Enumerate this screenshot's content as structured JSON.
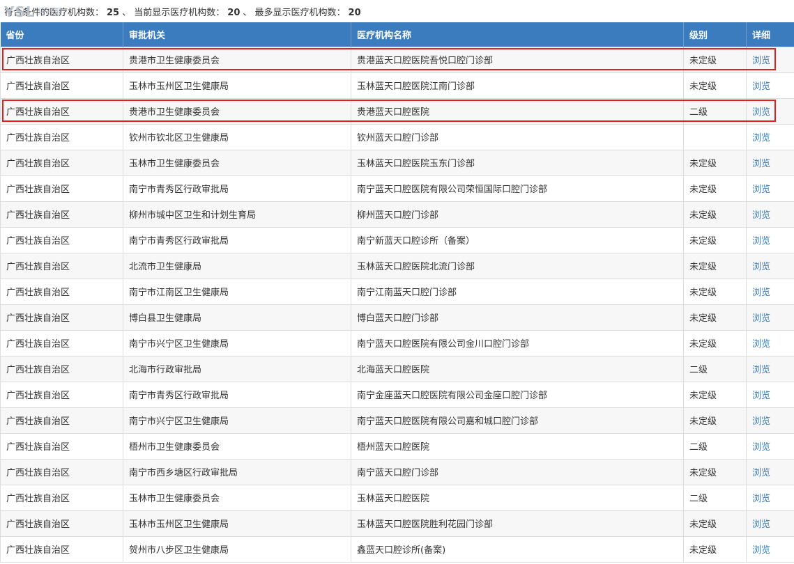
{
  "summary": {
    "label_total": "符合条件的医疗机构数：",
    "total": "25",
    "sep1": "、",
    "label_shown": "当前显示医疗机构数：",
    "shown": "20",
    "sep2": "、",
    "label_max": "最多显示医疗机构数：",
    "max": "20"
  },
  "watermark": {
    "latin": "YSL",
    "cjk": "牙舒丽"
  },
  "headers": {
    "province": "省份",
    "authority": "审批机关",
    "name": "医疗机构名称",
    "level": "级别",
    "detail": "详细"
  },
  "colors": {
    "header_bg": "#3a7cbd",
    "link": "#3a7cbd",
    "highlight": "#e0201f"
  },
  "highlighted_rows": [
    0,
    2
  ],
  "rows": [
    {
      "province": "广西壮族自治区",
      "authority": "贵港市卫生健康委员会",
      "name": "贵港蓝天口腔医院吾悦口腔门诊部",
      "level": "未定级",
      "detail": "浏览"
    },
    {
      "province": "广西壮族自治区",
      "authority": "玉林市玉州区卫生健康局",
      "name": "玉林蓝天口腔医院江南门诊部",
      "level": "未定级",
      "detail": "浏览"
    },
    {
      "province": "广西壮族自治区",
      "authority": "贵港市卫生健康委员会",
      "name": "贵港蓝天口腔医院",
      "level": "二级",
      "detail": "浏览"
    },
    {
      "province": "广西壮族自治区",
      "authority": "钦州市钦北区卫生健康局",
      "name": "钦州蓝天口腔门诊部",
      "level": "",
      "detail": "浏览"
    },
    {
      "province": "广西壮族自治区",
      "authority": "玉林市卫生健康委员会",
      "name": "玉林蓝天口腔医院玉东门诊部",
      "level": "未定级",
      "detail": "浏览"
    },
    {
      "province": "广西壮族自治区",
      "authority": "南宁市青秀区行政审批局",
      "name": "南宁蓝天口腔医院有限公司荣恒国际口腔门诊部",
      "level": "未定级",
      "detail": "浏览"
    },
    {
      "province": "广西壮族自治区",
      "authority": "柳州市城中区卫生和计划生育局",
      "name": "柳州蓝天口腔门诊部",
      "level": "未定级",
      "detail": "浏览"
    },
    {
      "province": "广西壮族自治区",
      "authority": "南宁市青秀区行政审批局",
      "name": "南宁新蓝天口腔诊所（备案）",
      "level": "未定级",
      "detail": "浏览"
    },
    {
      "province": "广西壮族自治区",
      "authority": "北流市卫生健康局",
      "name": "玉林蓝天口腔医院北流门诊部",
      "level": "未定级",
      "detail": "浏览"
    },
    {
      "province": "广西壮族自治区",
      "authority": "南宁市江南区卫生健康局",
      "name": "南宁江南蓝天口腔门诊部",
      "level": "未定级",
      "detail": "浏览"
    },
    {
      "province": "广西壮族自治区",
      "authority": "博白县卫生健康局",
      "name": "博白蓝天口腔门诊部",
      "level": "未定级",
      "detail": "浏览"
    },
    {
      "province": "广西壮族自治区",
      "authority": "南宁市兴宁区卫生健康局",
      "name": "南宁蓝天口腔医院有限公司金川口腔门诊部",
      "level": "未定级",
      "detail": "浏览"
    },
    {
      "province": "广西壮族自治区",
      "authority": "北海市行政审批局",
      "name": "北海蓝天口腔医院",
      "level": "二级",
      "detail": "浏览"
    },
    {
      "province": "广西壮族自治区",
      "authority": "南宁市青秀区行政审批局",
      "name": "南宁金座蓝天口腔医院有限公司金座口腔门诊部",
      "level": "未定级",
      "detail": "浏览"
    },
    {
      "province": "广西壮族自治区",
      "authority": "南宁市兴宁区卫生健康局",
      "name": "南宁蓝天口腔医院有限公司嘉和城口腔门诊部",
      "level": "未定级",
      "detail": "浏览"
    },
    {
      "province": "广西壮族自治区",
      "authority": "梧州市卫生健康委员会",
      "name": "梧州蓝天口腔医院",
      "level": "二级",
      "detail": "浏览"
    },
    {
      "province": "广西壮族自治区",
      "authority": "南宁市西乡塘区行政审批局",
      "name": "南宁蓝天口腔门诊部",
      "level": "未定级",
      "detail": "浏览"
    },
    {
      "province": "广西壮族自治区",
      "authority": "玉林市卫生健康委员会",
      "name": "玉林蓝天口腔医院",
      "level": "二级",
      "detail": "浏览"
    },
    {
      "province": "广西壮族自治区",
      "authority": "玉林市玉州区卫生健康局",
      "name": "玉林蓝天口腔医院胜利花园门诊部",
      "level": "未定级",
      "detail": "浏览"
    },
    {
      "province": "广西壮族自治区",
      "authority": "贺州市八步区卫生健康局",
      "name": "鑫蓝天口腔诊所(备案)",
      "level": "未定级",
      "detail": "浏览"
    }
  ]
}
